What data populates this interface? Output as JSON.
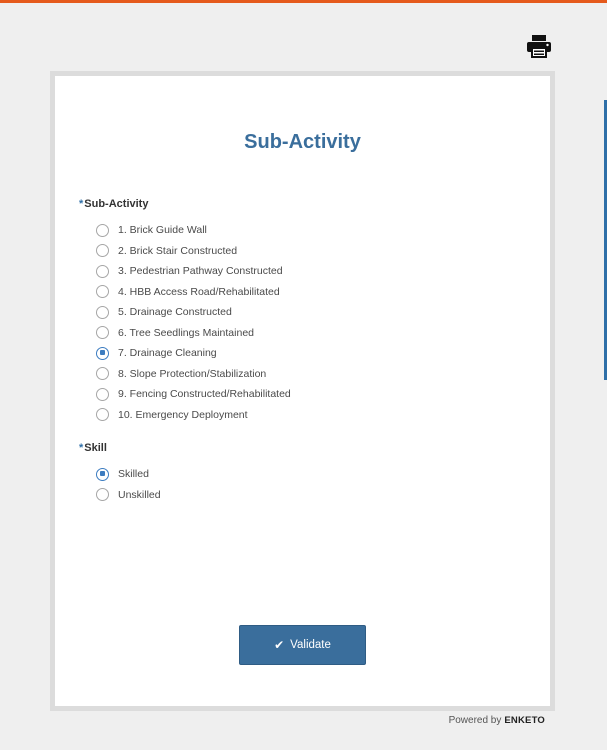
{
  "form": {
    "title": "Sub-Activity",
    "validate_label": "Validate"
  },
  "questions": {
    "sub_activity": {
      "required_marker": "*",
      "label": "Sub-Activity",
      "options": [
        {
          "label": "1. Brick Guide Wall",
          "checked": false
        },
        {
          "label": "2. Brick Stair Constructed",
          "checked": false
        },
        {
          "label": "3. Pedestrian Pathway Constructed",
          "checked": false
        },
        {
          "label": "4. HBB Access Road/Rehabilitated",
          "checked": false
        },
        {
          "label": "5. Drainage Constructed",
          "checked": false
        },
        {
          "label": "6. Tree Seedlings Maintained",
          "checked": false
        },
        {
          "label": "7. Drainage Cleaning",
          "checked": true
        },
        {
          "label": "8. Slope Protection/Stabilization",
          "checked": false
        },
        {
          "label": "9. Fencing Constructed/Rehabilitated",
          "checked": false
        },
        {
          "label": "10. Emergency Deployment",
          "checked": false
        }
      ]
    },
    "skill": {
      "required_marker": "*",
      "label": "Skill",
      "options": [
        {
          "label": "Skilled",
          "checked": true
        },
        {
          "label": "Unskilled",
          "checked": false
        }
      ]
    }
  },
  "footer": {
    "powered_by": "Powered by",
    "brand": "ENKETO"
  },
  "icons": {
    "print": "printer-icon",
    "validate": "check-icon"
  },
  "colors": {
    "accent": "#3a6e9c",
    "top_bar": "#e55a1c",
    "radio_checked": "#3c7cc0"
  }
}
